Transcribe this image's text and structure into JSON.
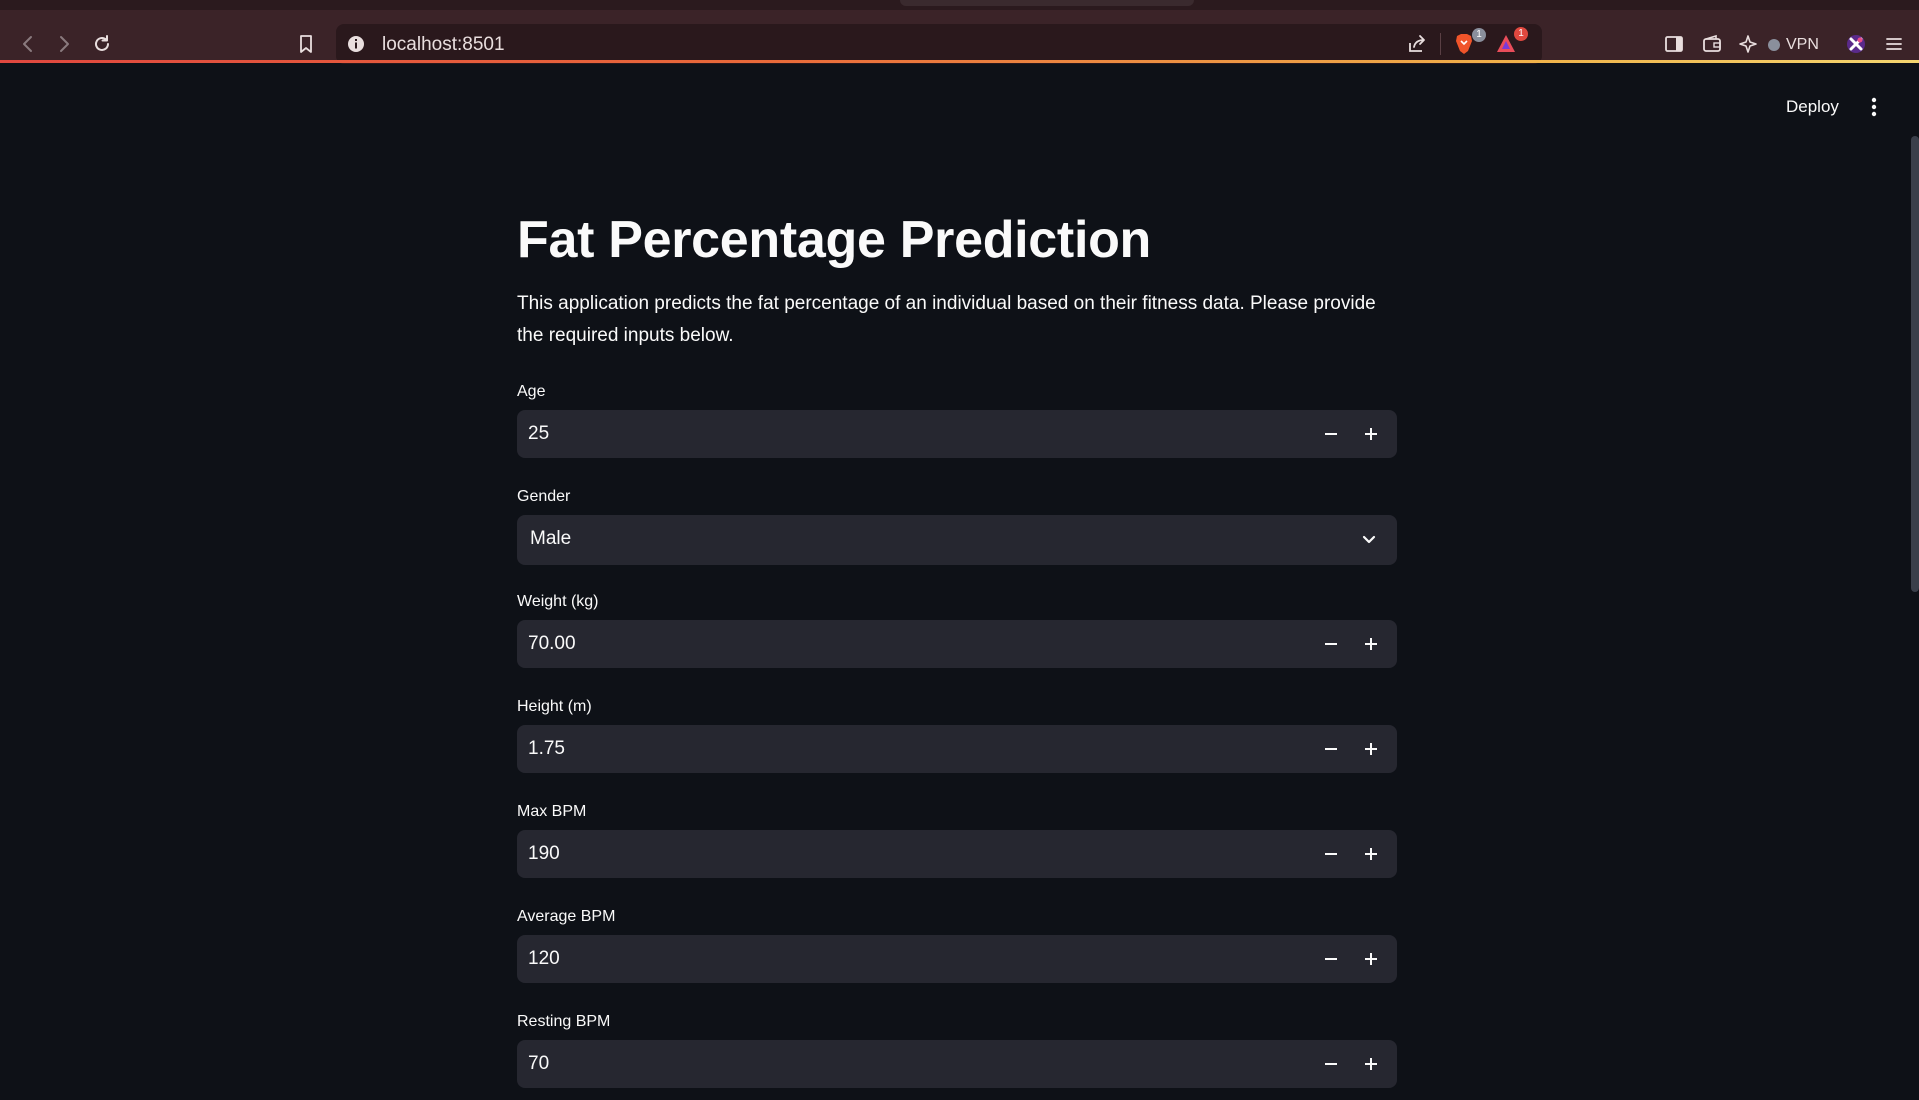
{
  "browser": {
    "url": "localhost:8501",
    "vpn_label": "VPN",
    "brave_badge": "1",
    "rewards_badge": "1",
    "icons": [
      "back-icon",
      "forward-icon",
      "reload-icon",
      "bookmark-icon",
      "info-icon",
      "share-icon",
      "brave-shields-icon",
      "brave-rewards-icon",
      "sidebar-icon",
      "wallet-icon",
      "leo-ai-icon",
      "vpn-icon",
      "profile-icon",
      "menu-icon"
    ],
    "accent_colors": [
      "#e0483f",
      "#f5d670"
    ]
  },
  "app": {
    "deploy_label": "Deploy",
    "title": "Fat Percentage Prediction",
    "description": "This application predicts the fat percentage of an individual based on their fitness data. Please provide the required inputs below.",
    "background": "#0e1117",
    "input_background": "#262730",
    "fields": {
      "age": {
        "label": "Age",
        "value": "25"
      },
      "gender": {
        "label": "Gender",
        "value": "Male"
      },
      "weight": {
        "label": "Weight (kg)",
        "value": "70.00"
      },
      "height": {
        "label": "Height (m)",
        "value": "1.75"
      },
      "max_bpm": {
        "label": "Max BPM",
        "value": "190"
      },
      "avg_bpm": {
        "label": "Average BPM",
        "value": "120"
      },
      "resting_bpm": {
        "label": "Resting BPM",
        "value": "70"
      }
    }
  }
}
